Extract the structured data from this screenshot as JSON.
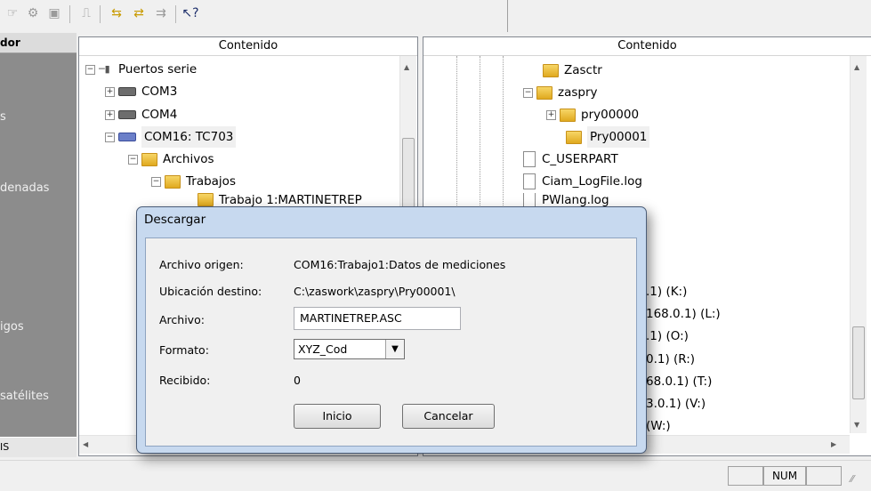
{
  "sidebar": {
    "header": "dor",
    "items": [
      "s",
      "denadas",
      "igos",
      "satélites"
    ],
    "bottom": "IS"
  },
  "left_panel": {
    "header": "Contenido",
    "tree": [
      {
        "label": "Puertos serie"
      },
      {
        "label": "COM3"
      },
      {
        "label": "COM4"
      },
      {
        "label": "COM16: TC703"
      },
      {
        "label": "Archivos"
      },
      {
        "label": "Trabajos"
      },
      {
        "label": "Trabajo 1:MARTINETREP"
      }
    ]
  },
  "right_panel": {
    "header": "Contenido",
    "tree": [
      {
        "label": "Zasctr"
      },
      {
        "label": "zaspry"
      },
      {
        "label": "pry00000"
      },
      {
        "label": "Pry00001"
      },
      {
        "label": "C_USERPART"
      },
      {
        "label": "Ciam_LogFile.log"
      },
      {
        "label": "PWlang.log"
      }
    ],
    "drives": [
      ".1) (K:)",
      "168.0.1) (L:)",
      ".1) (O:)",
      "0.1) (R:)",
      "68.0.1) (T:)",
      "3.0.1) (V:)",
      "(W:)"
    ]
  },
  "dialog": {
    "title": "Descargar",
    "source_label": "Archivo origen:",
    "source_value": "COM16:Trabajo1:Datos de mediciones",
    "dest_label": "Ubicación destino:",
    "dest_value": "C:\\zaswork\\zaspry\\Pry00001\\",
    "file_label": "Archivo:",
    "file_value": "MARTINETREP.ASC",
    "format_label": "Formato:",
    "format_value": "XYZ_Cod",
    "received_label": "Recibido:",
    "received_value": "0",
    "start_button": "Inicio",
    "cancel_button": "Cancelar"
  },
  "statusbar": {
    "num": "NUM"
  }
}
